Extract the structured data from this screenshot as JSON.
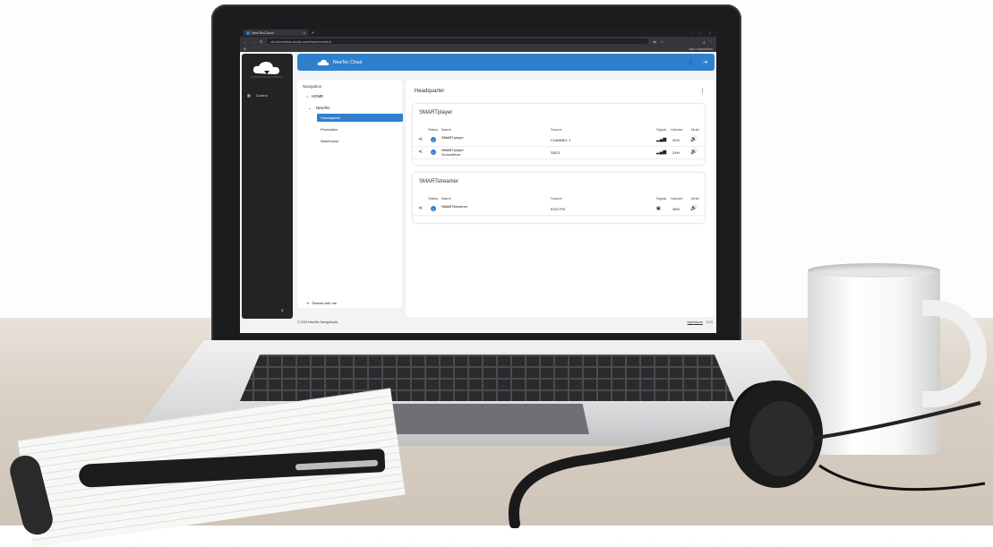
{
  "browser": {
    "tab_title": "NewTecCloud",
    "tab_close": "×",
    "new_tab": "+",
    "url": "cloud.newtec-audio.com/home/control",
    "bookmarks_right": "Alle Lesezeichen"
  },
  "app": {
    "brand": "NewTec Cloud",
    "sidebar": {
      "items": [
        {
          "label": "Control",
          "icon": "grid-icon"
        }
      ],
      "collapse": "‹"
    },
    "navigation": {
      "title": "Navigation",
      "home": "HOME",
      "org": "NewTec",
      "children": [
        "Headquarter",
        "Production",
        "Warehouse"
      ],
      "selected": "Headquarter",
      "shared": "Shared with me"
    },
    "main": {
      "title": "Headquarter",
      "cards": [
        {
          "title": "SMARTplayer",
          "headers": [
            "Status",
            "Name",
            "Source",
            "Signal",
            "Volume",
            "Mute"
          ],
          "rows": [
            {
              "name": "SMARTplayer",
              "sub": "Serialnr.",
              "source": "CHANNEL 1",
              "volume": "30%"
            },
            {
              "name": "SMARTplayer Groundfloor",
              "sub": "Serialnr.",
              "source": "SSD1",
              "volume": "24%"
            }
          ]
        },
        {
          "title": "SMARTstreamer",
          "headers": [
            "Status",
            "Name",
            "Source",
            "Signal",
            "Volume",
            "Mute"
          ],
          "rows": [
            {
              "name": "SMARTstreamer",
              "sub": "Serialnr.",
              "source": "EGO FM",
              "volume": "48%"
            }
          ]
        }
      ]
    },
    "footer": {
      "copyright": "© 2024 NewTec DesignAudio",
      "impressum": "Impressum",
      "version": "V1.0"
    }
  }
}
